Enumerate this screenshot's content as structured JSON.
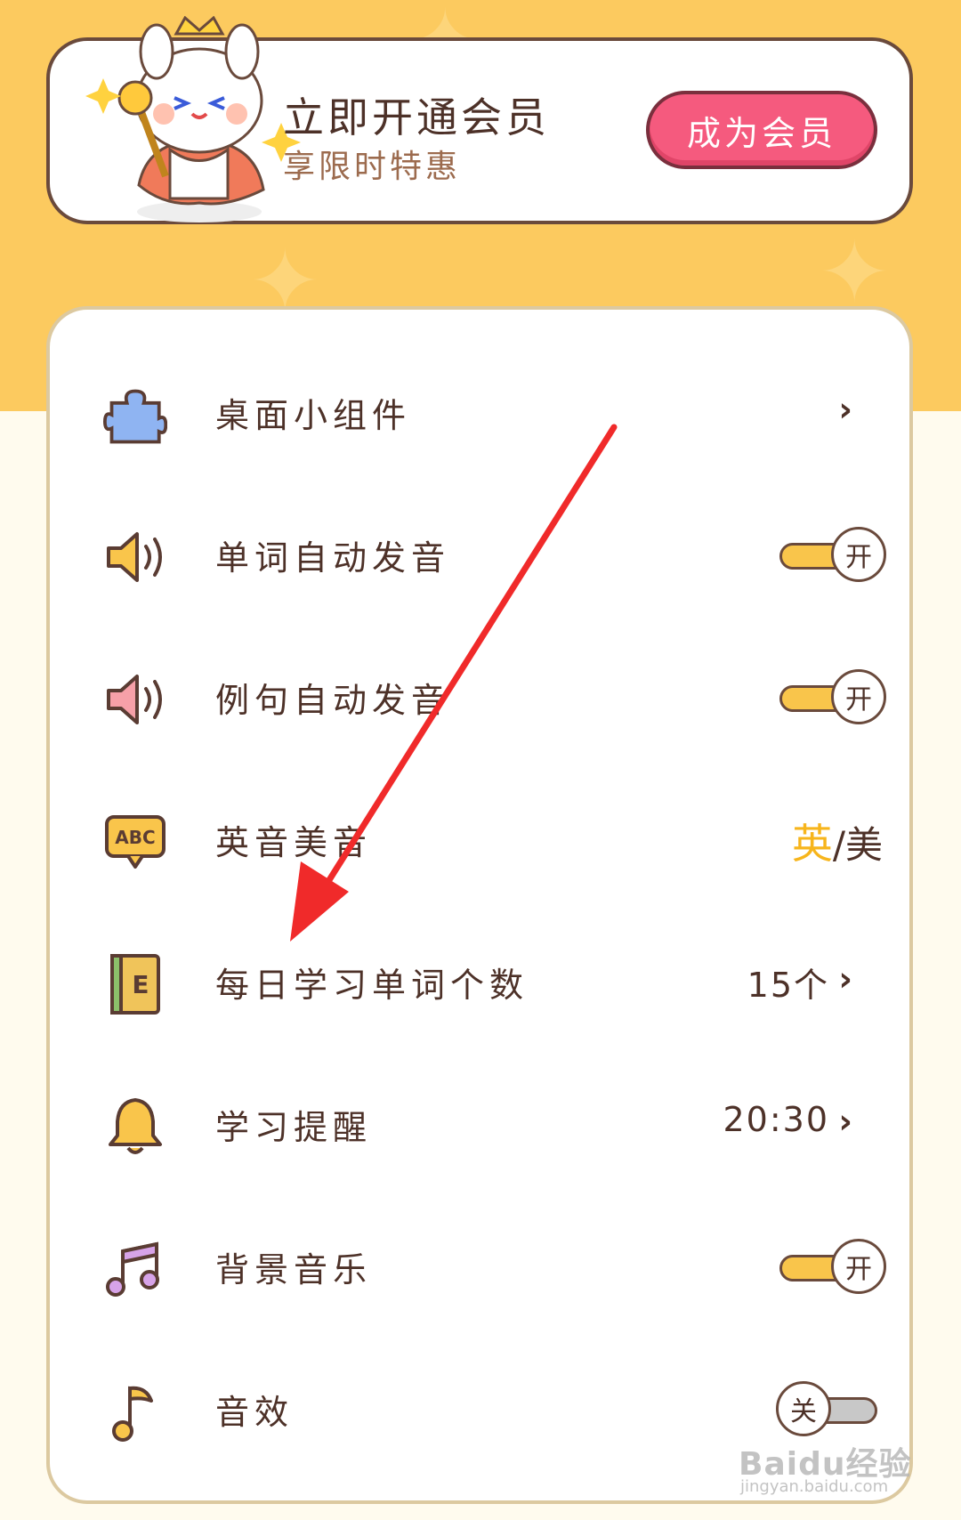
{
  "vip": {
    "title": "立即开通会员",
    "subtitle": "享限时特惠",
    "button": "成为会员"
  },
  "settings": [
    {
      "label": "桌面小组件",
      "icon": "puzzle-icon",
      "control": "chevron"
    },
    {
      "label": "单词自动发音",
      "icon": "speaker-icon",
      "control": "toggle",
      "state": "开"
    },
    {
      "label": "例句自动发音",
      "icon": "speaker-icon",
      "control": "toggle",
      "state": "开"
    },
    {
      "label": "英音美音",
      "icon": "abc-speech-icon",
      "control": "choice",
      "active": "英",
      "separator": "/",
      "inactive": "美"
    },
    {
      "label": "每日学习单词个数",
      "icon": "book-icon",
      "control": "value",
      "value": "15个"
    },
    {
      "label": "学习提醒",
      "icon": "bell-icon",
      "control": "value",
      "value": "20:30"
    },
    {
      "label": "背景音乐",
      "icon": "music-notes-icon",
      "control": "toggle",
      "state": "开"
    },
    {
      "label": "音效",
      "icon": "music-note-icon",
      "control": "toggle",
      "state": "关"
    }
  ],
  "colors": {
    "header_bg": "#fcca5f",
    "vip_button": "#f55a7e",
    "toggle_on": "#f9c54b",
    "toggle_off": "#c8c8c8",
    "accent_active": "#f7b51c",
    "annotation_arrow": "#f02a2a"
  },
  "watermark": {
    "brand": "Baidu经验",
    "url": "jingyan.baidu.com"
  }
}
